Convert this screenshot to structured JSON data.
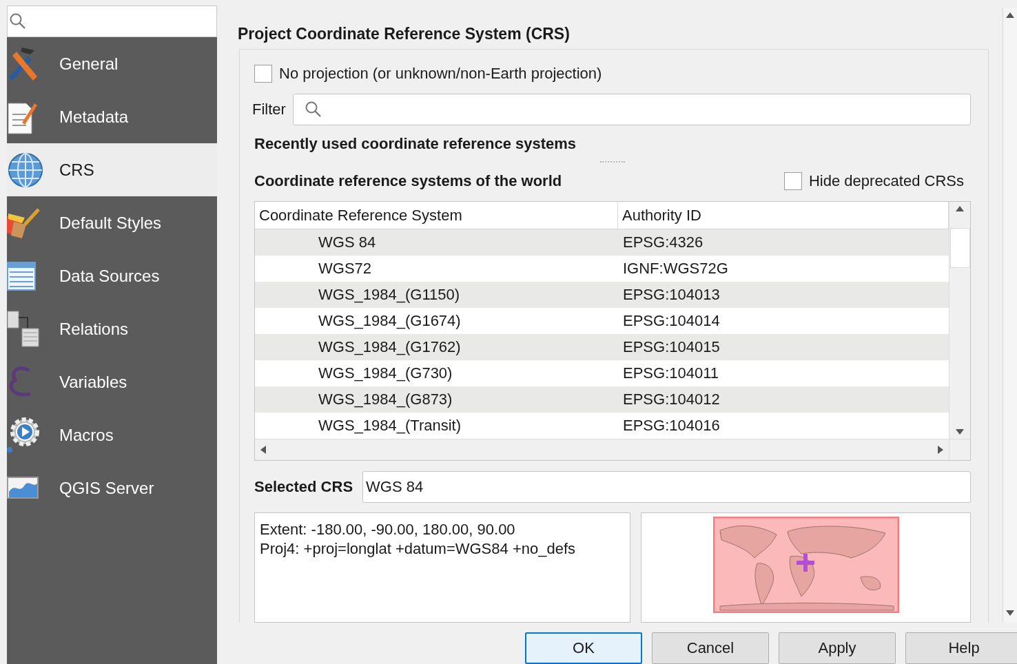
{
  "sidebar": {
    "items": [
      {
        "label": "General",
        "selected": false
      },
      {
        "label": "Metadata",
        "selected": false
      },
      {
        "label": "CRS",
        "selected": true
      },
      {
        "label": "Default Styles",
        "selected": false
      },
      {
        "label": "Data Sources",
        "selected": false
      },
      {
        "label": "Relations",
        "selected": false
      },
      {
        "label": "Variables",
        "selected": false
      },
      {
        "label": "Macros",
        "selected": false
      },
      {
        "label": "QGIS Server",
        "selected": false
      }
    ]
  },
  "section_title": "Project Coordinate Reference System (CRS)",
  "no_projection": {
    "label": "No projection (or unknown/non-Earth projection)",
    "checked": false
  },
  "filter": {
    "label": "Filter"
  },
  "recent_heading": "Recently used coordinate reference systems",
  "world_heading": "Coordinate reference systems of the world",
  "hide_deprecated": {
    "label": "Hide deprecated CRSs",
    "checked": false
  },
  "table": {
    "columns": [
      "Coordinate Reference System",
      "Authority ID"
    ],
    "rows": [
      {
        "name": "WGS 84",
        "authority_id": "EPSG:4326"
      },
      {
        "name": "WGS72",
        "authority_id": "IGNF:WGS72G"
      },
      {
        "name": "WGS_1984_(G1150)",
        "authority_id": "EPSG:104013"
      },
      {
        "name": "WGS_1984_(G1674)",
        "authority_id": "EPSG:104014"
      },
      {
        "name": "WGS_1984_(G1762)",
        "authority_id": "EPSG:104015"
      },
      {
        "name": "WGS_1984_(G730)",
        "authority_id": "EPSG:104011"
      },
      {
        "name": "WGS_1984_(G873)",
        "authority_id": "EPSG:104012"
      },
      {
        "name": "WGS_1984_(Transit)",
        "authority_id": "EPSG:104016"
      }
    ]
  },
  "selected_crs": {
    "label": "Selected CRS",
    "value": "WGS 84"
  },
  "details": [
    "Extent: -180.00, -90.00, 180.00, 90.00",
    "Proj4: +proj=longlat +datum=WGS84 +no_defs"
  ],
  "buttons": [
    {
      "label": "OK",
      "default": true
    },
    {
      "label": "Cancel",
      "default": false
    },
    {
      "label": "Apply",
      "default": false
    },
    {
      "label": "Help",
      "default": false
    }
  ]
}
